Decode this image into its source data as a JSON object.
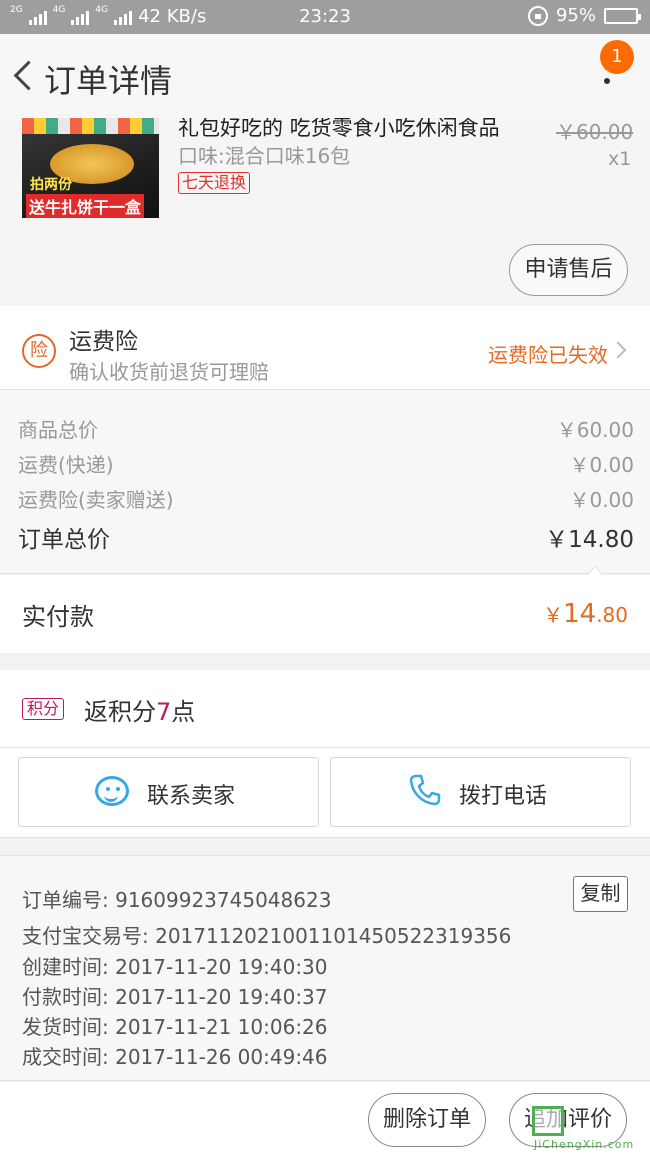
{
  "status_bar": {
    "speed": "42 KB/s",
    "net1": "2G",
    "net2": "4G",
    "net3": "4G",
    "time": "23:23",
    "battery": "95%",
    "battery_level": 0.95
  },
  "header": {
    "title": "订单详情",
    "badge_count": "1"
  },
  "product": {
    "name": "礼包好吃的 吃货零食小吃休闲食品",
    "original_price": "￥60.00",
    "spec": "口味:混合口味16包",
    "quantity": "x1",
    "return_tag": "七天退换",
    "image_promo_line1": "拍两份",
    "image_promo_line2": "送牛扎饼干一盒",
    "after_sale_label": "申请售后"
  },
  "insurance": {
    "icon_text": "险",
    "title": "运费险",
    "subtitle": "确认收货前退货可理赔",
    "status": "运费险已失效"
  },
  "prices": [
    {
      "label": "商品总价",
      "value": "￥60.00"
    },
    {
      "label": "运费(快递)",
      "value": "￥0.00"
    },
    {
      "label": "运费险(卖家赠送)",
      "value": "￥0.00"
    }
  ],
  "order_total": {
    "label": "订单总价",
    "value": "￥14.80"
  },
  "paid": {
    "label": "实付款",
    "currency": "￥",
    "integer": "14",
    "decimal": ".80"
  },
  "points": {
    "tag": "积分",
    "prefix": "返积分",
    "count": "7",
    "suffix": "点"
  },
  "contact": {
    "seller_label": "联系卖家",
    "phone_label": "拨打电话"
  },
  "order_info": {
    "lines": [
      "订单编号: 91609923745048623",
      "支付宝交易号: 2017112021001101450522319356",
      "创建时间: 2017-11-20 19:40:30",
      "付款时间: 2017-11-20 19:40:37",
      "发货时间: 2017-11-21 10:06:26",
      "成交时间: 2017-11-26 00:49:46"
    ],
    "copy_label": "复制"
  },
  "actions": {
    "delete_label": "删除订单",
    "review_label": "追加评价"
  },
  "watermark": {
    "text": "JiChengXin.com"
  },
  "colors": {
    "accent_orange": "#e66a1e",
    "badge": "#ff6a00",
    "points": "#c2185b",
    "icon_blue": "#35a9e6"
  }
}
